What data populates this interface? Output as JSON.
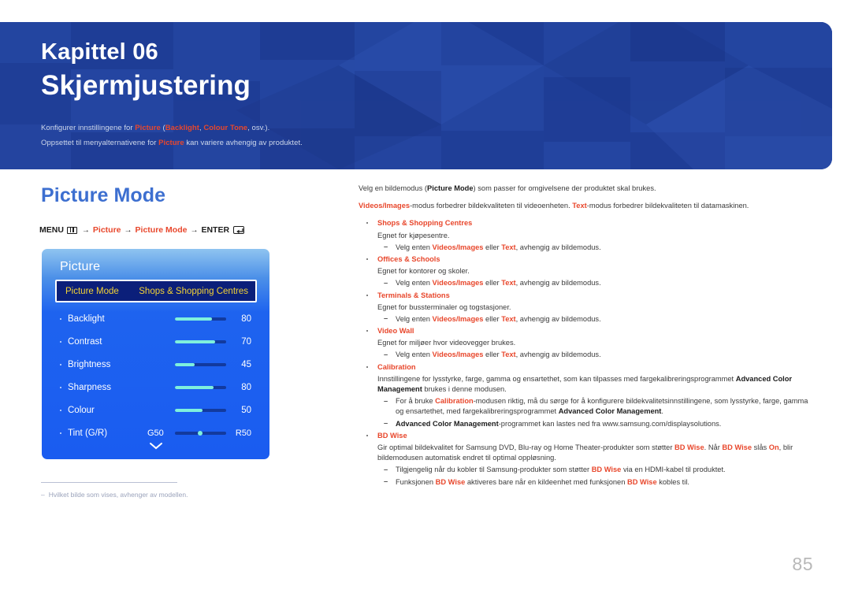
{
  "header": {
    "chapter_label": "Kapittel 06",
    "chapter_title": "Skjermjustering",
    "note1_pre": "Konfigurer innstillingene for ",
    "note1_t1": "Picture",
    "note1_mid": " (",
    "note1_t2": "Backlight",
    "note1_mid2": ", ",
    "note1_t3": "Colour Tone",
    "note1_post": ", osv.).",
    "note2_pre": "Oppsettet til menyalternativene for ",
    "note2_t1": "Picture",
    "note2_post": " kan variere avhengig av produktet."
  },
  "section": {
    "title": "Picture Mode",
    "menu_path": {
      "menu": "MENU",
      "arrow": "→",
      "item1": "Picture",
      "item2": "Picture Mode",
      "enter": "ENTER"
    }
  },
  "osd": {
    "title": "Picture",
    "highlight": {
      "label": "Picture Mode",
      "value": "Shops & Shopping Centres"
    },
    "rows": [
      {
        "label": "Backlight",
        "value": "80",
        "fill_pct": 72
      },
      {
        "label": "Contrast",
        "value": "70",
        "fill_pct": 78
      },
      {
        "label": "Brightness",
        "value": "45",
        "fill_pct": 38
      },
      {
        "label": "Sharpness",
        "value": "80",
        "fill_pct": 76
      },
      {
        "label": "Colour",
        "value": "50",
        "fill_pct": 54
      }
    ],
    "tint": {
      "label": "Tint (G/R)",
      "left": "G50",
      "right": "R50"
    },
    "chevron": "chevron-down-icon"
  },
  "footnote": {
    "dash": "–",
    "text": "Hvilket bilde som vises, avhenger av modellen."
  },
  "body": {
    "p1_a": "Velg en bildemodus (",
    "p1_b": "Picture Mode",
    "p1_c": ") som passer for omgivelsene der produktet skal brukes.",
    "p2_a": "Videos/Images",
    "p2_b": "-modus forbedrer bildekvaliteten til videoenheten. ",
    "p2_c": "Text",
    "p2_d": "-modus forbedrer bildekvaliteten til datamaskinen.",
    "sub_common_a": "Velg enten ",
    "sub_common_b": "Videos/Images",
    "sub_common_c": " eller ",
    "sub_common_d": "Text",
    "sub_common_e": ", avhengig av bildemodus.",
    "items": [
      {
        "head": "Shops & Shopping Centres",
        "desc": "Egnet for kjøpesentre."
      },
      {
        "head": "Offices & Schools",
        "desc": "Egnet for kontorer og skoler."
      },
      {
        "head": "Terminals & Stations",
        "desc": "Egnet for bussterminaler og togstasjoner."
      },
      {
        "head": "Video Wall",
        "desc": "Egnet for miljøer hvor videovegger brukes."
      }
    ],
    "calibration": {
      "head": "Calibration",
      "desc_a": "Innstillingene for lysstyrke, farge, gamma og ensartethet, som kan tilpasses med fargekalibreringsprogrammet ",
      "desc_b": "Advanced Color Management",
      "desc_c": " brukes i denne modusen.",
      "sub1_a": "For å bruke ",
      "sub1_b": "Calibration",
      "sub1_c": "-modusen riktig, må du sørge for å konfigurere bildekvalitetsinnstillingene, som lysstyrke, farge, gamma og ensartethet, med fargekalibreringsprogrammet ",
      "sub1_d": "Advanced Color Management",
      "sub1_e": ".",
      "sub2_a": "Advanced Color Management",
      "sub2_b": "-programmet kan lastes ned fra www.samsung.com/displaysolutions."
    },
    "bdwise": {
      "head": "BD Wise",
      "desc_a": "Gir optimal bildekvalitet for Samsung DVD, Blu-ray og Home Theater-produkter som støtter ",
      "desc_b": "BD Wise",
      "desc_c": ". Når ",
      "desc_d": "BD Wise",
      "desc_e": " slås ",
      "desc_f": "On",
      "desc_g": ", blir bildemodusen automatisk endret til optimal oppløsning.",
      "sub1_a": "Tilgjengelig når du kobler til Samsung-produkter som støtter ",
      "sub1_b": "BD Wise",
      "sub1_c": " via en HDMI-kabel til produktet.",
      "sub2_a": "Funksjonen ",
      "sub2_b": "BD Wise",
      "sub2_c": " aktiveres bare når en kildeenhet med funksjonen ",
      "sub2_d": "BD Wise",
      "sub2_e": " kobles til."
    }
  },
  "page_number": "85",
  "colors": {
    "header_blue": "#21409a",
    "accent_red": "#e8472c",
    "title_blue": "#3d6fd0",
    "osd_blue": "#1a5cf0",
    "osd_gold": "#f4d335",
    "slider_fill": "#7ef0dd"
  }
}
